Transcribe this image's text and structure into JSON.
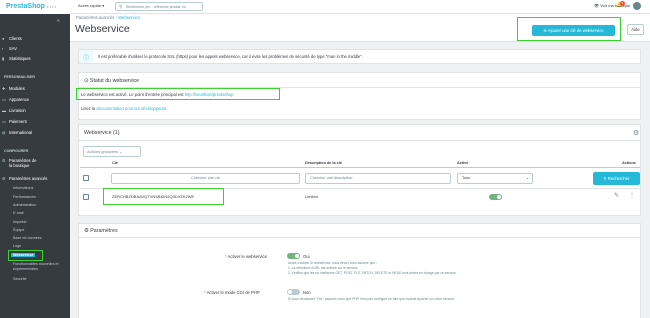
{
  "topbar": {
    "logo": "PrestaShop",
    "version": "1.7.7.1",
    "quick_access": "Accès rapide ▾",
    "search_placeholder": "Rechercher (ex. : référence produit, no",
    "my_store": "Voir ma boutique",
    "notification_count": "3"
  },
  "sidebar": {
    "items": [
      {
        "label": "Clients",
        "icon": "account-icon"
      },
      {
        "label": "SAV",
        "icon": "chat-icon"
      },
      {
        "label": "Statistiques",
        "icon": "chart-icon"
      }
    ],
    "section_personnaliser": "PERSONNALISER",
    "items2": [
      {
        "label": "Modules",
        "icon": "puzzle-icon"
      },
      {
        "label": "Apparence",
        "icon": "desktop-icon"
      },
      {
        "label": "Livraison",
        "icon": "truck-icon"
      },
      {
        "label": "Paiement",
        "icon": "card-icon"
      },
      {
        "label": "International",
        "icon": "globe-icon"
      }
    ],
    "section_configurer": "CONFIGURER",
    "items3": [
      {
        "label": "Paramètres de la boutique",
        "label_line1": "Paramètres de",
        "label_line2": "la boutique",
        "icon": "gear-icon"
      },
      {
        "label": "Paramètres avancés",
        "icon": "settings-icon"
      }
    ],
    "subitems": [
      "Informations",
      "Performances",
      "Administration",
      "E-mail",
      "Importer",
      "Équipe",
      "Base de données",
      "Logs",
      "Webservice",
      "Fonctionnalités nouvelles et expérimentales",
      "Sécurité"
    ],
    "subitem_long_line1": "Fonctionnalités nouvelles et",
    "subitem_long_line2": "expérimentales"
  },
  "header": {
    "breadcrumb_parent": "Paramètres avancés",
    "breadcrumb_current": "Webservice",
    "title": "Webservice",
    "add_key_button": "Ajouter une clé de webservice",
    "help_button": "Aide"
  },
  "alert": {
    "text": "Il est préférable d'utiliser le protocole SSL (https) pour les appels webservice, car il évite les problèmes de sécurité de type \"man in the middle\"."
  },
  "status_card": {
    "title": "Statut du webservice",
    "active_text": "Le webservice est activé. Le point d'entrée principal est ",
    "entry_url": "http://localhost/prestashop",
    "read_prefix": "Lisez la ",
    "doc_link": "documentation pour les développeurs."
  },
  "list_card": {
    "title": "Webservice (1)",
    "bulk_actions": "Actions groupées",
    "columns": {
      "key": "Clé",
      "description": "Description de la clé",
      "enabled": "Activé",
      "actions": "Actions"
    },
    "filter_key_placeholder": "Chercher une clé",
    "filter_desc_placeholder": "Chercher une description",
    "filter_enabled_value": "Tous",
    "search_button": "Rechercher",
    "rows": [
      {
        "key": "ZERCHBZDBAAVQTVNSBKIN2Q3DXZK2WE",
        "description": "Limited",
        "enabled": true
      }
    ]
  },
  "settings_card": {
    "title": "Paramètres",
    "enable_label": "Activer le webservice",
    "enable_value": "Oui",
    "enable_help_1": "Avant d'activer le webservice, vous devez vous assurer que :",
    "enable_help_2": "1. La réécriture d'URL est activée sur le serveur.",
    "enable_help_3": "2. Vérifiez que les six méthodes GET, POST, PUT, PATCH, DELETE et HEAD sont prises en charge par ce serveur.",
    "cgi_label": "Activer le mode CGI de PHP",
    "cgi_value": "Non",
    "cgi_help": "Si vous choisissez \"Oui\", assurez-vous que PHP n'est pas configuré en tant que module Apache sur votre serveur."
  },
  "colors": {
    "accent": "#25b9d7",
    "highlight": "#3bd12f",
    "sidebar": "#363a41",
    "toggle_on": "#70b580",
    "toggle_off": "#bbcdd2"
  }
}
